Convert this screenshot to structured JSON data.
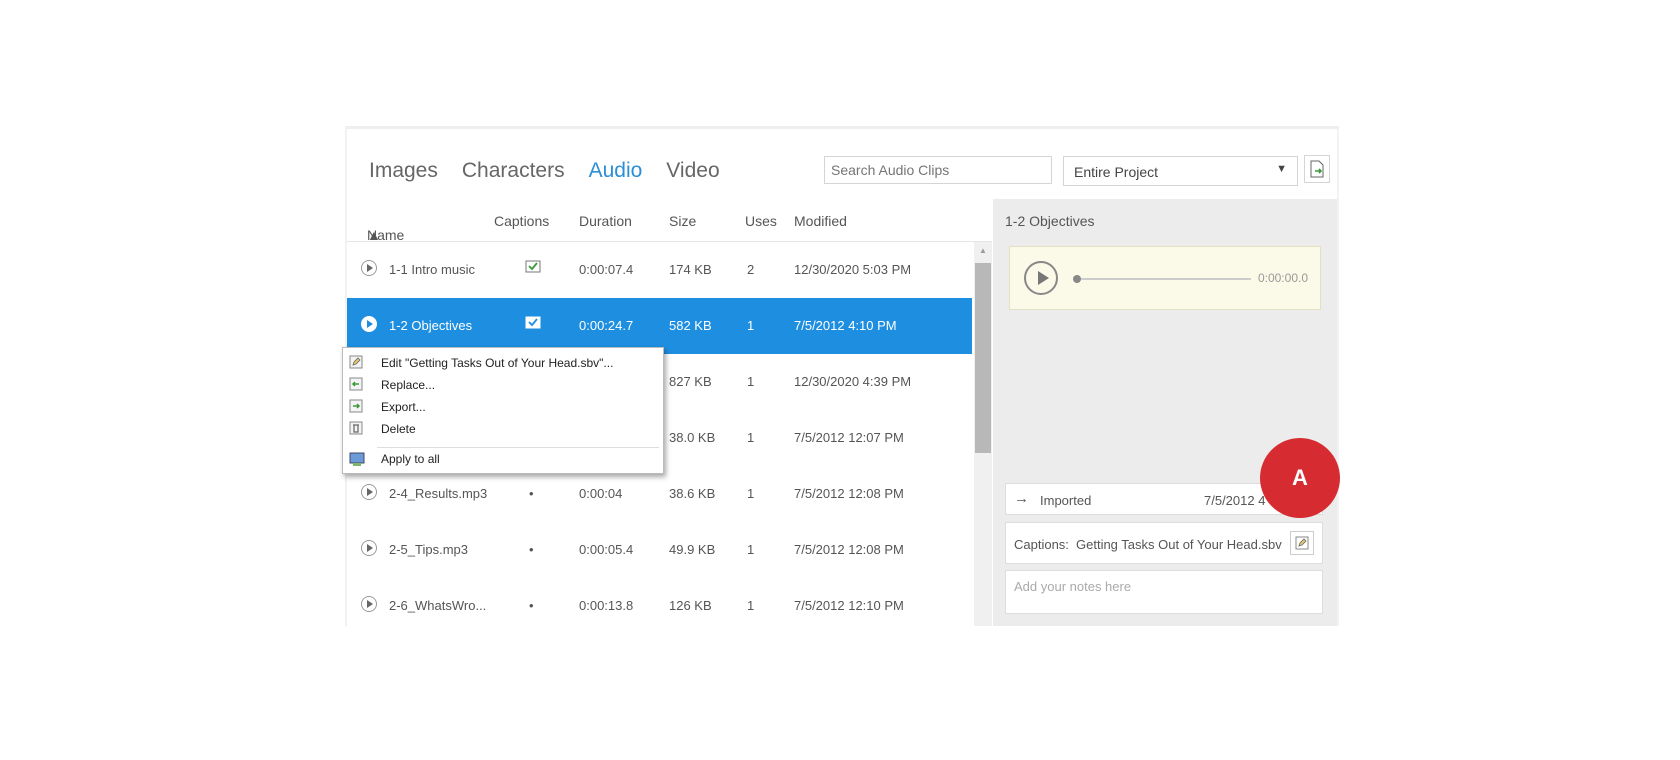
{
  "tabs": [
    "Images",
    "Characters",
    "Audio",
    "Video"
  ],
  "active_tab": "Audio",
  "search": {
    "placeholder": "Search Audio Clips"
  },
  "scope": {
    "value": "Entire Project"
  },
  "table": {
    "headers": {
      "name": "Name",
      "captions": "Captions",
      "duration": "Duration",
      "size": "Size",
      "uses": "Uses",
      "modified": "Modified"
    },
    "rows": [
      {
        "name": "1-1 Intro music",
        "captions": "check",
        "duration": "0:00:07.4",
        "size": "174 KB",
        "uses": "2",
        "modified": "12/30/2020 5:03 PM"
      },
      {
        "name": "1-2 Objectives",
        "captions": "check",
        "duration": "0:00:24.7",
        "size": "582 KB",
        "uses": "1",
        "modified": "7/5/2012 4:10 PM"
      },
      {
        "name": "",
        "captions": "",
        "duration": "",
        "size": "827 KB",
        "uses": "1",
        "modified": "12/30/2020 4:39 PM"
      },
      {
        "name": "",
        "captions": "",
        "duration": "",
        "size": "38.0 KB",
        "uses": "1",
        "modified": "7/5/2012 12:07 PM"
      },
      {
        "name": "2-4_Results.mp3",
        "captions": "•",
        "duration": "0:00:04",
        "size": "38.6 KB",
        "uses": "1",
        "modified": "7/5/2012 12:08 PM"
      },
      {
        "name": "2-5_Tips.mp3",
        "captions": "•",
        "duration": "0:00:05.4",
        "size": "49.9 KB",
        "uses": "1",
        "modified": "7/5/2012 12:08 PM"
      },
      {
        "name": "2-6_WhatsWro...",
        "captions": "•",
        "duration": "0:00:13.8",
        "size": "126 KB",
        "uses": "1",
        "modified": "7/5/2012 12:10 PM"
      }
    ]
  },
  "context_menu": {
    "items": [
      {
        "label": "Edit \"Getting Tasks Out of Your Head.sbv\"...",
        "icon": "edit-icon"
      },
      {
        "label": "Replace...",
        "icon": "replace-icon"
      },
      {
        "label": "Export...",
        "icon": "export-icon"
      },
      {
        "label": "Delete",
        "icon": "delete-icon"
      },
      {
        "label": "Apply to all",
        "icon": "apply-all-icon"
      }
    ]
  },
  "detail": {
    "title": "1-2 Objectives",
    "player_time": "0:00:00.0",
    "imported_label": "Imported",
    "imported_date": "7/5/2012 4",
    "captions_label": "Captions:",
    "captions_file": "Getting Tasks Out of Your Head.sbv",
    "notes_placeholder": "Add your notes here"
  },
  "badge": "A",
  "colors": {
    "accent": "#1e8ee1",
    "tab_active": "#2a8fd6",
    "badge": "#d62b30"
  }
}
